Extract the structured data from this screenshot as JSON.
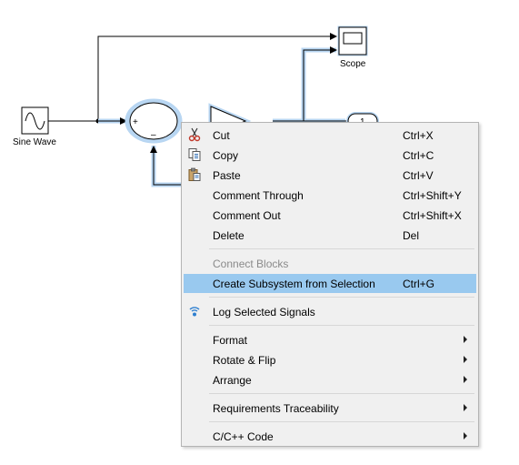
{
  "diagram": {
    "blocks": {
      "sine_wave": "Sine Wave",
      "scope": "Scope",
      "sum_signs": [
        "+",
        "–"
      ],
      "outport_number": "1"
    }
  },
  "context_menu": {
    "cut": {
      "label": "Cut",
      "shortcut": "Ctrl+X",
      "icon": "scissors-icon"
    },
    "copy": {
      "label": "Copy",
      "shortcut": "Ctrl+C",
      "icon": "copy-icon"
    },
    "paste": {
      "label": "Paste",
      "shortcut": "Ctrl+V",
      "icon": "paste-icon"
    },
    "comment_through": {
      "label": "Comment Through",
      "shortcut": "Ctrl+Shift+Y"
    },
    "comment_out": {
      "label": "Comment Out",
      "shortcut": "Ctrl+Shift+X"
    },
    "delete": {
      "label": "Delete",
      "shortcut": "Del"
    },
    "connect_blocks": {
      "label": "Connect Blocks",
      "disabled": true
    },
    "create_subsystem": {
      "label": "Create Subsystem from Selection",
      "shortcut": "Ctrl+G",
      "highlighted": true
    },
    "log_signals": {
      "label": "Log Selected Signals",
      "icon": "signal-logging-icon"
    },
    "format": {
      "label": "Format",
      "submenu": true
    },
    "rotate_flip": {
      "label": "Rotate & Flip",
      "submenu": true
    },
    "arrange": {
      "label": "Arrange",
      "submenu": true
    },
    "requirements": {
      "label": "Requirements Traceability",
      "submenu": true
    },
    "cc_code": {
      "label": "C/C++ Code",
      "submenu": true
    }
  },
  "colors": {
    "menu_background": "#f0f0f0",
    "highlight": "#99c9ef",
    "selection_glow": "#b8d6f2",
    "signal_line": "#000000"
  }
}
